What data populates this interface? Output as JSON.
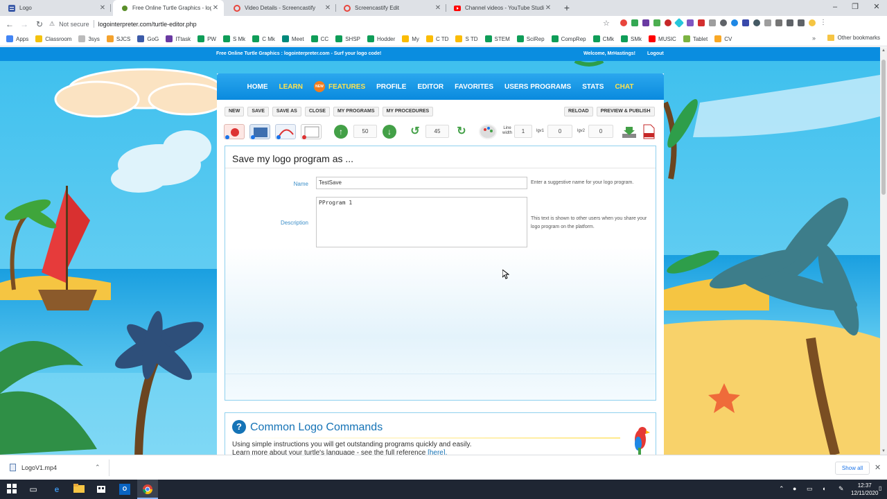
{
  "browser": {
    "tabs": [
      {
        "title": "Logo",
        "favicon": "#3c5ba8"
      },
      {
        "title": "Free Online Turtle Graphics - log",
        "favicon": "#5a8f2a"
      },
      {
        "title": "Video Details - Screencastify",
        "favicon": "#e8453c"
      },
      {
        "title": "Screencastify Edit",
        "favicon": "#e8453c"
      },
      {
        "title": "Channel videos - YouTube Studio",
        "favicon": "#ff0000"
      }
    ],
    "security": "Not secure",
    "url": "logointerpreter.com/turtle-editor.php",
    "bookmarks": [
      "Apps",
      "Classroom",
      "3sys",
      "SJCS",
      "GoG",
      "ITtask",
      "PW",
      "S Mk",
      "C Mk",
      "Meet",
      "CC",
      "SHSP",
      "Hodder",
      "My",
      "C TD",
      "S TD",
      "STEM",
      "SciRep",
      "CompRep",
      "CMk",
      "SMk",
      "MUSIC",
      "Tablet",
      "CV"
    ],
    "other_bookmarks": "Other bookmarks"
  },
  "site": {
    "tagline": "Free Online Turtle Graphics : logointerpreter.com - Surf your logo code!",
    "welcome": "Welcome, MrHastings!",
    "logout": "Logout",
    "nav": [
      {
        "label": "HOME",
        "highlight": false
      },
      {
        "label": "LEARN",
        "highlight": true
      },
      {
        "label": "FEATURES",
        "highlight": true,
        "badge": "NEW"
      },
      {
        "label": "PROFILE",
        "highlight": false
      },
      {
        "label": "EDITOR",
        "highlight": false
      },
      {
        "label": "FAVORITES",
        "highlight": false
      },
      {
        "label": "USERS PROGRAMS",
        "highlight": false
      },
      {
        "label": "STATS",
        "highlight": false
      },
      {
        "label": "CHAT",
        "highlight": true
      }
    ],
    "left_buttons": [
      "NEW",
      "SAVE",
      "SAVE AS",
      "CLOSE",
      "MY PROGRAMS",
      "MY PROCEDURES"
    ],
    "right_buttons": [
      "RELOAD",
      "PREVIEW & PUBLISH"
    ],
    "toolbar": {
      "move_value": "50",
      "turn_value": "45",
      "line_width_label": "Line width",
      "line_width_value": "1",
      "lgv1_label": "lgv1",
      "lgv1_value": "0",
      "lgv2_label": "lgv2",
      "lgv2_value": "0"
    },
    "form": {
      "heading": "Save my logo program as ...",
      "name_label": "Name",
      "name_value": "TestSave",
      "name_hint": "Enter a suggestive name for your logo program.",
      "description_label": "Description",
      "description_value": "PProgram 1",
      "description_hint": "This text is shown to other users when you share your logo program on the platform."
    },
    "commands": {
      "title": "Common Logo Commands",
      "line1": "Using simple instructions you will get outstanding programs quickly and easily.",
      "line2": "Learn more about your turtle's language - see the full reference",
      "link": "[here]."
    }
  },
  "downloads": {
    "file": "LogoV1.mp4",
    "show_all": "Show all"
  },
  "system": {
    "time": "12:37",
    "date": "12/11/2020"
  }
}
